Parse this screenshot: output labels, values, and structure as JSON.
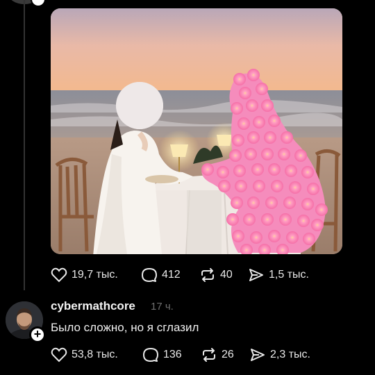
{
  "post1": {
    "actions": {
      "likes": "19,7 тыс.",
      "replies": "412",
      "reposts": "40",
      "shares": "1,5 тыс."
    }
  },
  "post2": {
    "username": "cybermathcore",
    "timestamp": "17 ч.",
    "text": "Было сложно, но я сглазил",
    "actions": {
      "likes": "53,8 тыс.",
      "replies": "136",
      "reposts": "26",
      "shares": "2,3 тыс."
    }
  },
  "icons": {
    "like": "heart-icon",
    "reply": "speech-bubble-icon",
    "repost": "repost-arrows-icon",
    "share": "send-icon",
    "follow": "plus-icon"
  },
  "colors": {
    "background": "#000000",
    "text": "#f2f2f2",
    "muted": "#6f6f6f",
    "thread_line": "#333333"
  }
}
